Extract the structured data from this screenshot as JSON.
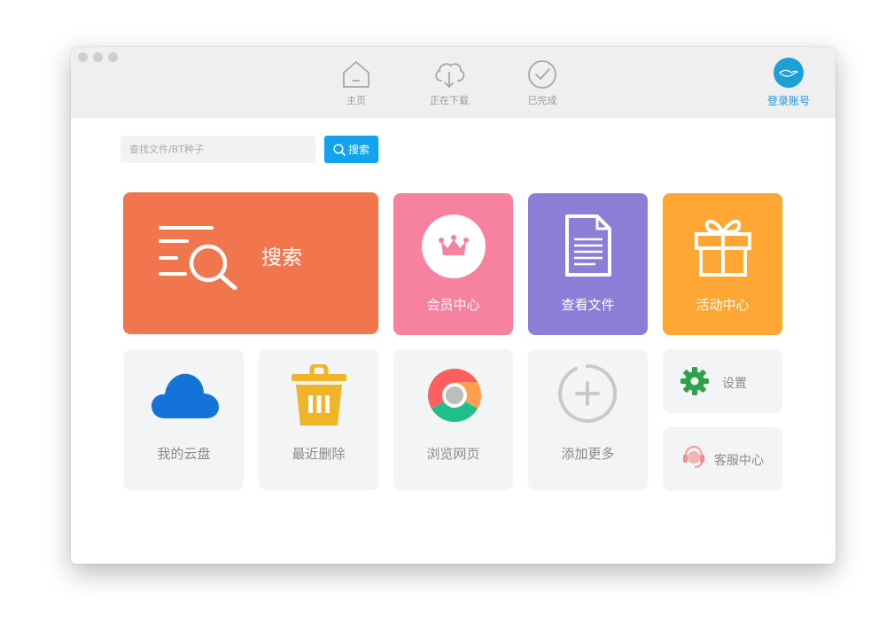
{
  "nav": {
    "home_label": "主页",
    "downloading_label": "正在下载",
    "completed_label": "已完成",
    "account_label": "登录账号"
  },
  "search": {
    "placeholder": "查找文件/BT种子",
    "button_label": "搜索"
  },
  "tiles": {
    "search_label": "搜索",
    "vip_label": "会员中心",
    "files_label": "查看文件",
    "activity_label": "活动中心",
    "cloud_label": "我的云盘",
    "trash_label": "最近删除",
    "browser_label": "浏览网页",
    "add_label": "添加更多",
    "settings_label": "设置",
    "service_label": "客服中心"
  },
  "colors": {
    "accent": "#11a3ee",
    "search_tile": "#f2764d",
    "vip_tile": "#f7829f",
    "files_tile": "#8c7ed6",
    "activity_tile": "#ffa735",
    "gray_tile": "#f3f4f6"
  },
  "icons": {
    "home": "home-icon",
    "download": "cloud-download-icon",
    "completed": "check-circle-icon",
    "avatar": "bird-logo-icon",
    "search": "magnifier-list-icon",
    "vip": "crown-icon",
    "files": "document-icon",
    "activity": "gift-icon",
    "cloud": "cloud-icon",
    "trash": "trash-icon",
    "browser": "chrome-icon",
    "add": "plus-circle-icon",
    "settings": "gear-icon",
    "service": "headset-icon"
  }
}
